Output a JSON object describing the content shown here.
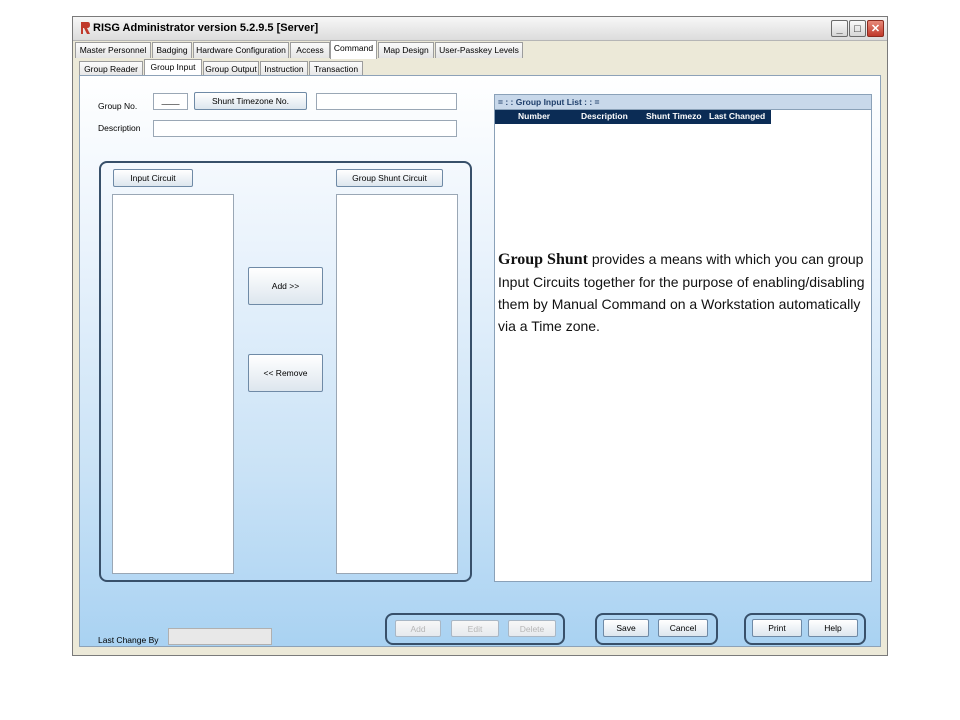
{
  "window": {
    "title": "RISG Administrator version 5.2.9.5 [Server]",
    "controls": {
      "minimize": "_",
      "maximize": "□",
      "close": "✕"
    },
    "logo_color": "#c0392b"
  },
  "main_tabs": [
    "Master Personnel",
    "Badging",
    "Hardware Configuration",
    "Access",
    "Command",
    "Map Design",
    "User-Passkey Levels"
  ],
  "main_tab_active": "Command",
  "sub_tabs": [
    "Group Reader",
    "Group Input",
    "Group Output",
    "Instruction",
    "Transaction"
  ],
  "sub_tab_active": "Group Input",
  "form": {
    "group_no_label": "Group No.",
    "group_no_value": "____",
    "shunt_timezone_button": "Shunt Timezone No.",
    "description_label": "Description",
    "input_circuit_button": "Input Circuit",
    "group_shunt_circuit_button": "Group Shunt Circuit",
    "add_button": "Add >>",
    "remove_button": "<< Remove",
    "last_change_label": "Last Change By"
  },
  "list": {
    "header": "= : : Group Input  List : : =",
    "columns": [
      "Number",
      "Description",
      "Shunt Timezo",
      "Last Changed"
    ]
  },
  "bottom_buttons": {
    "add": "Add",
    "edit": "Edit",
    "delete": "Delete",
    "save": "Save",
    "cancel": "Cancel",
    "print": "Print",
    "help": "Help"
  },
  "overlay": {
    "bold": "Group Shunt",
    "text": " provides a means with which you can group Input Circuits together for the purpose of enabling/disabling them by Manual Command on a Workstation automatically via a Time zone."
  }
}
